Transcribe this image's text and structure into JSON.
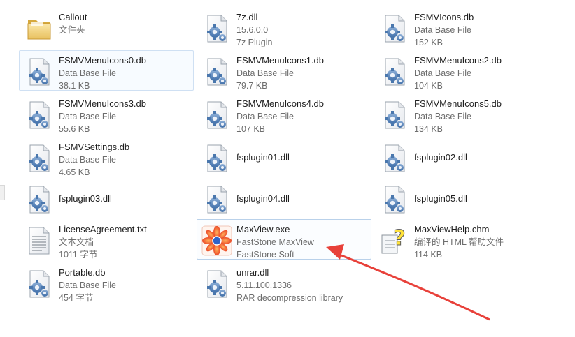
{
  "files": [
    {
      "name": "Callout",
      "line1": "文件夹",
      "line2": "",
      "icon": "folder-icon"
    },
    {
      "name": "7z.dll",
      "line1": "15.6.0.0",
      "line2": "7z Plugin",
      "icon": "dll-gear-icon"
    },
    {
      "name": "FSMVIcons.db",
      "line1": "Data Base File",
      "line2": "152 KB",
      "icon": "db-gear-icon"
    },
    {
      "name": "FSMVMenuIcons0.db",
      "line1": "Data Base File",
      "line2": "38.1 KB",
      "icon": "db-gear-icon"
    },
    {
      "name": "FSMVMenuIcons1.db",
      "line1": "Data Base File",
      "line2": "79.7 KB",
      "icon": "db-gear-icon"
    },
    {
      "name": "FSMVMenuIcons2.db",
      "line1": "Data Base File",
      "line2": "104 KB",
      "icon": "db-gear-icon"
    },
    {
      "name": "FSMVMenuIcons3.db",
      "line1": "Data Base File",
      "line2": "55.6 KB",
      "icon": "db-gear-icon"
    },
    {
      "name": "FSMVMenuIcons4.db",
      "line1": "Data Base File",
      "line2": "107 KB",
      "icon": "db-gear-icon"
    },
    {
      "name": "FSMVMenuIcons5.db",
      "line1": "Data Base File",
      "line2": "134 KB",
      "icon": "db-gear-icon"
    },
    {
      "name": "FSMVSettings.db",
      "line1": "Data Base File",
      "line2": "4.65 KB",
      "icon": "db-gear-icon"
    },
    {
      "name": "fsplugin01.dll",
      "line1": "",
      "line2": "",
      "icon": "dll-gear-icon"
    },
    {
      "name": "fsplugin02.dll",
      "line1": "",
      "line2": "",
      "icon": "dll-gear-icon"
    },
    {
      "name": "fsplugin03.dll",
      "line1": "",
      "line2": "",
      "icon": "dll-gear-icon"
    },
    {
      "name": "fsplugin04.dll",
      "line1": "",
      "line2": "",
      "icon": "dll-gear-icon"
    },
    {
      "name": "fsplugin05.dll",
      "line1": "",
      "line2": "",
      "icon": "dll-gear-icon"
    },
    {
      "name": "LicenseAgreement.txt",
      "line1": "文本文档",
      "line2": "1011 字节",
      "icon": "text-document-icon"
    },
    {
      "name": "MaxView.exe",
      "line1": "FastStone MaxView",
      "line2": "FastStone Soft",
      "icon": "maxview-app-icon"
    },
    {
      "name": "MaxViewHelp.chm",
      "line1": "编译的 HTML 帮助文件",
      "line2": "114 KB",
      "icon": "chm-help-icon"
    },
    {
      "name": "Portable.db",
      "line1": "Data Base File",
      "line2": "454 字节",
      "icon": "db-gear-icon"
    },
    {
      "name": "unrar.dll",
      "line1": "5.11.100.1336",
      "line2": "RAR decompression library",
      "icon": "dll-gear-icon"
    }
  ],
  "colors": {
    "arrow": "#e8413a",
    "hover_border": "#cfe0f3",
    "selected_border": "#b9d1ea"
  }
}
